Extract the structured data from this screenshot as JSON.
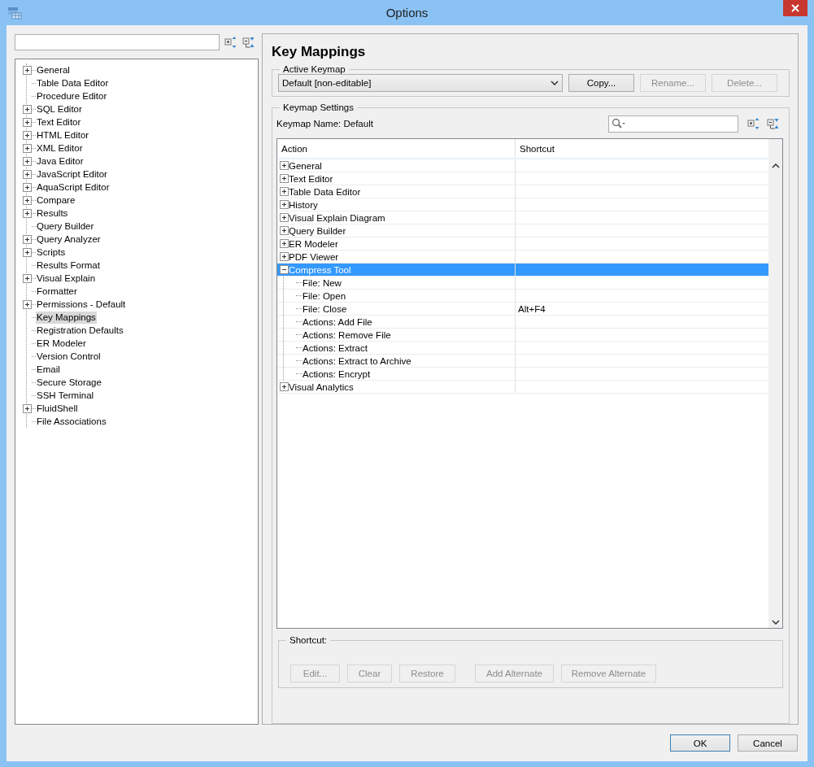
{
  "window": {
    "title": "Options"
  },
  "sidebar": {
    "items": [
      {
        "label": "General",
        "kind": "group",
        "selected": false
      },
      {
        "label": "Table Data Editor",
        "kind": "leaf",
        "selected": false
      },
      {
        "label": "Procedure Editor",
        "kind": "leaf",
        "selected": false
      },
      {
        "label": "SQL Editor",
        "kind": "group",
        "selected": false
      },
      {
        "label": "Text Editor",
        "kind": "group",
        "selected": false
      },
      {
        "label": "HTML Editor",
        "kind": "group",
        "selected": false
      },
      {
        "label": "XML Editor",
        "kind": "group",
        "selected": false
      },
      {
        "label": "Java Editor",
        "kind": "group",
        "selected": false
      },
      {
        "label": "JavaScript Editor",
        "kind": "group",
        "selected": false
      },
      {
        "label": "AquaScript Editor",
        "kind": "group",
        "selected": false
      },
      {
        "label": "Compare",
        "kind": "group",
        "selected": false
      },
      {
        "label": "Results",
        "kind": "group",
        "selected": false
      },
      {
        "label": "Query Builder",
        "kind": "leaf",
        "selected": false
      },
      {
        "label": "Query Analyzer",
        "kind": "group",
        "selected": false
      },
      {
        "label": "Scripts",
        "kind": "group",
        "selected": false
      },
      {
        "label": "Results Format",
        "kind": "leaf",
        "selected": false
      },
      {
        "label": "Visual Explain",
        "kind": "group",
        "selected": false
      },
      {
        "label": "Formatter",
        "kind": "leaf",
        "selected": false
      },
      {
        "label": "Permissions - Default",
        "kind": "group",
        "selected": false
      },
      {
        "label": "Key Mappings",
        "kind": "leaf",
        "selected": true
      },
      {
        "label": "Registration Defaults",
        "kind": "leaf",
        "selected": false
      },
      {
        "label": "ER Modeler",
        "kind": "leaf",
        "selected": false
      },
      {
        "label": "Version Control",
        "kind": "leaf",
        "selected": false
      },
      {
        "label": "Email",
        "kind": "leaf",
        "selected": false
      },
      {
        "label": "Secure Storage",
        "kind": "leaf",
        "selected": false
      },
      {
        "label": "SSH Terminal",
        "kind": "leaf",
        "selected": false
      },
      {
        "label": "FluidShell",
        "kind": "group",
        "selected": false
      },
      {
        "label": "File Associations",
        "kind": "leaf",
        "selected": false
      }
    ]
  },
  "page": {
    "title": "Key Mappings",
    "active_keymap": {
      "legend": "Active Keymap",
      "dropdown": "Default [non-editable]",
      "buttons": [
        {
          "label": "Copy...",
          "disabled": false
        },
        {
          "label": "Rename...",
          "disabled": true
        },
        {
          "label": "Delete...",
          "disabled": true
        }
      ]
    },
    "settings": {
      "legend": "Keymap Settings",
      "keymap_name": "Keymap Name: Default",
      "table": {
        "columns": [
          "Action",
          "Shortcut"
        ],
        "rows": [
          {
            "action": "General",
            "kind": "group",
            "expanded": false,
            "selected": false
          },
          {
            "action": "Text Editor",
            "kind": "group",
            "expanded": false,
            "selected": false
          },
          {
            "action": "Table Data Editor",
            "kind": "group",
            "expanded": false,
            "selected": false
          },
          {
            "action": "History",
            "kind": "group",
            "expanded": false,
            "selected": false
          },
          {
            "action": "Visual Explain Diagram",
            "kind": "group",
            "expanded": false,
            "selected": false
          },
          {
            "action": "Query Builder",
            "kind": "group",
            "expanded": false,
            "selected": false
          },
          {
            "action": "ER Modeler",
            "kind": "group",
            "expanded": false,
            "selected": false
          },
          {
            "action": "PDF Viewer",
            "kind": "group",
            "expanded": false,
            "selected": false
          },
          {
            "action": "Compress Tool",
            "kind": "group",
            "expanded": true,
            "selected": true,
            "children": [
              {
                "action": "File: New",
                "kind": "leaf",
                "selected": false
              },
              {
                "action": "File: Open",
                "kind": "leaf",
                "selected": false
              },
              {
                "action": "File: Close",
                "shortcut": "Alt+F4",
                "kind": "leaf",
                "selected": false
              },
              {
                "action": "Actions: Add File",
                "kind": "leaf",
                "selected": false
              },
              {
                "action": "Actions: Remove File",
                "kind": "leaf",
                "selected": false
              },
              {
                "action": "Actions: Extract",
                "kind": "leaf",
                "selected": false
              },
              {
                "action": "Actions: Extract to Archive",
                "kind": "leaf",
                "selected": false
              },
              {
                "action": "Actions: Encrypt",
                "kind": "leaf",
                "selected": false
              }
            ]
          },
          {
            "action": "Visual Analytics",
            "kind": "group",
            "expanded": false,
            "selected": false
          }
        ]
      },
      "shortcut": {
        "legend": "Shortcut:",
        "buttons": [
          {
            "label": "Edit...",
            "disabled": true
          },
          {
            "label": "Clear",
            "disabled": true
          },
          {
            "label": "Restore",
            "disabled": true
          },
          {
            "label": "Add Alternate",
            "disabled": true
          },
          {
            "label": "Remove Alternate",
            "disabled": true
          }
        ]
      }
    }
  },
  "footer": {
    "buttons": [
      {
        "label": "OK",
        "kind": "default"
      },
      {
        "label": "Cancel",
        "kind": "normal"
      }
    ]
  }
}
